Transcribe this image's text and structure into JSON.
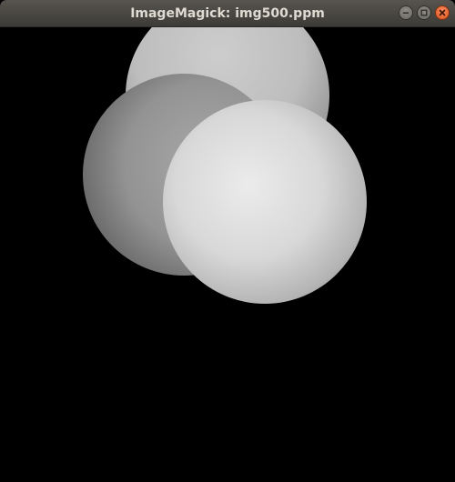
{
  "window": {
    "title": "ImageMagick: img500.ppm",
    "controls": [
      "minimize-icon",
      "maximize-icon",
      "close-icon"
    ],
    "colors": {
      "titlebar": "#3d3b37",
      "title_text": "#dfdbd2",
      "close_button": "#e1551f",
      "canvas_background": "#000000"
    }
  },
  "image": {
    "content": "three shaded grey spheres"
  }
}
